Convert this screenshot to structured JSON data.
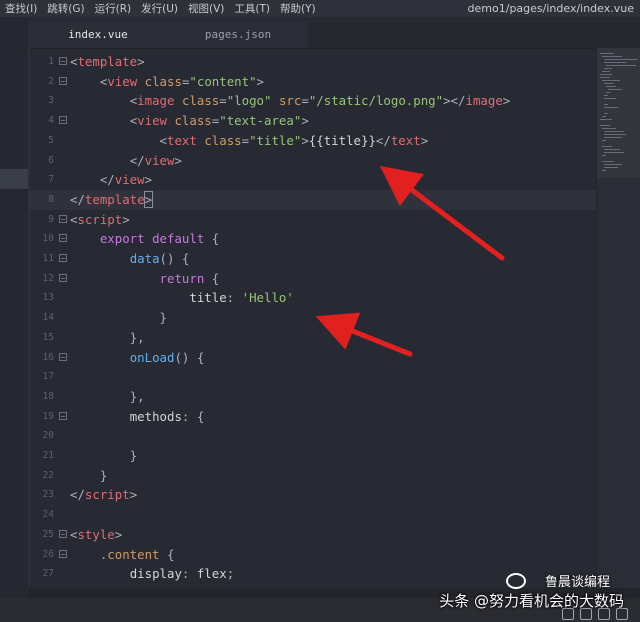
{
  "menubar": {
    "items": [
      "查找(I)",
      "跳转(G)",
      "运行(R)",
      "发行(U)",
      "视图(V)",
      "工具(T)",
      "帮助(Y)"
    ],
    "path": "demo1/pages/index/index.vue"
  },
  "tabs": [
    {
      "label": "index.vue",
      "active": true
    },
    {
      "label": "pages.json",
      "active": false
    }
  ],
  "editor": {
    "line_numbers": [
      "1",
      "2",
      "3",
      "4",
      "5",
      "6",
      "7",
      "8",
      "9",
      "10",
      "11",
      "12",
      "13",
      "14",
      "15",
      "16",
      "17",
      "18",
      "19",
      "20",
      "21",
      "22",
      "23",
      "24",
      "25",
      "26",
      "27"
    ]
  },
  "watermark": {
    "main": "头条 @努力看机会的大数码",
    "sub": "鲁晨谈编程"
  },
  "colors": {
    "background": "#272a32",
    "arrow": "#e32020",
    "tag": "#e06c75",
    "string": "#98c379",
    "keyword": "#c678dd",
    "function": "#61afef"
  }
}
